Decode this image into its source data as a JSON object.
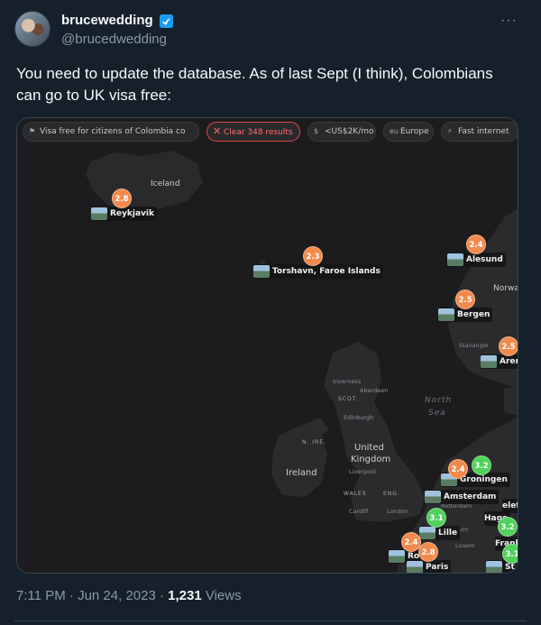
{
  "author": {
    "display_name": "brucewedding",
    "handle": "@brucedwedding"
  },
  "tweet": {
    "text": "You need to update the database. As of last Sept (I think), Colombians can go to UK visa free:",
    "time": "7:11 PM · Jun 24, 2023 · ",
    "views_count": "1,231",
    "views_label": " Views"
  },
  "map": {
    "filters": [
      {
        "icon": "flag-icon",
        "label": "Visa free for citizens of Colombia co"
      },
      {
        "icon": "close-icon",
        "label": "Clear 348 results"
      },
      {
        "icon": "money-icon",
        "label": "<US$2K/mo"
      },
      {
        "icon": "eu-icon",
        "label": "Europe"
      },
      {
        "icon": "wifi-icon",
        "label": "Fast internet"
      }
    ],
    "labels": {
      "iceland": "Iceland",
      "norway": "Norwa",
      "stavanger": "Stavanger",
      "inverness": "Inverness",
      "aberdeen": "Aberdeen",
      "scot": "SCOT.",
      "edinburgh": "Edinburgh",
      "north_sea_1": "North",
      "north_sea_2": "Sea",
      "nire": "N. IRE.",
      "uk_1": "United",
      "uk_2": "Kingdom",
      "ireland": "Ireland",
      "liverpool": "Liverpool",
      "wales": "WALES",
      "eng": "ENG.",
      "cardiff": "Cardiff",
      "london": "London",
      "luxem": "Luxem",
      "ium": "ium",
      "rotterdam": "Rotterdam",
      "ha": "Ha"
    },
    "cities": [
      {
        "name": "Reykjavik",
        "score": "2.8",
        "color": "#f28a4e"
      },
      {
        "name": "Torshavn, Faroe Islands",
        "score": "2.3",
        "color": "#f28a4e"
      },
      {
        "name": "Alesund",
        "score": "2.4",
        "color": "#f28a4e"
      },
      {
        "name": "Bergen",
        "score": "2.5",
        "color": "#f28a4e"
      },
      {
        "name": "Aren",
        "score": "2.5",
        "color": "#f28a4e"
      },
      {
        "name": "Groningen",
        "score": "3.2",
        "color": "#4fd15a"
      },
      {
        "name": "Amsterdam",
        "score": "2.4",
        "color": "#f28a4e"
      },
      {
        "name": "Lille",
        "score": "3.1",
        "color": "#4fd15a"
      },
      {
        "name": "Paris",
        "score": "2.8",
        "color": "#f28a4e"
      },
      {
        "name": "Ro",
        "score": "2.4",
        "color": "#f28a4e"
      },
      {
        "name": "Frank",
        "score": "3.2",
        "color": "#4fd15a"
      },
      {
        "name": "Hage",
        "score": "",
        "color": "#f28a4e"
      },
      {
        "name": "elefe",
        "score": "",
        "color": "#f28a4e"
      },
      {
        "name": "St",
        "score": "3.1",
        "color": "#4fd15a"
      }
    ]
  },
  "colors": {
    "background": "#15202b",
    "verified": "#1d9bf0",
    "orange_score": "#f28a4e",
    "green_score": "#4fd15a",
    "clear_filter": "#e0454c"
  }
}
